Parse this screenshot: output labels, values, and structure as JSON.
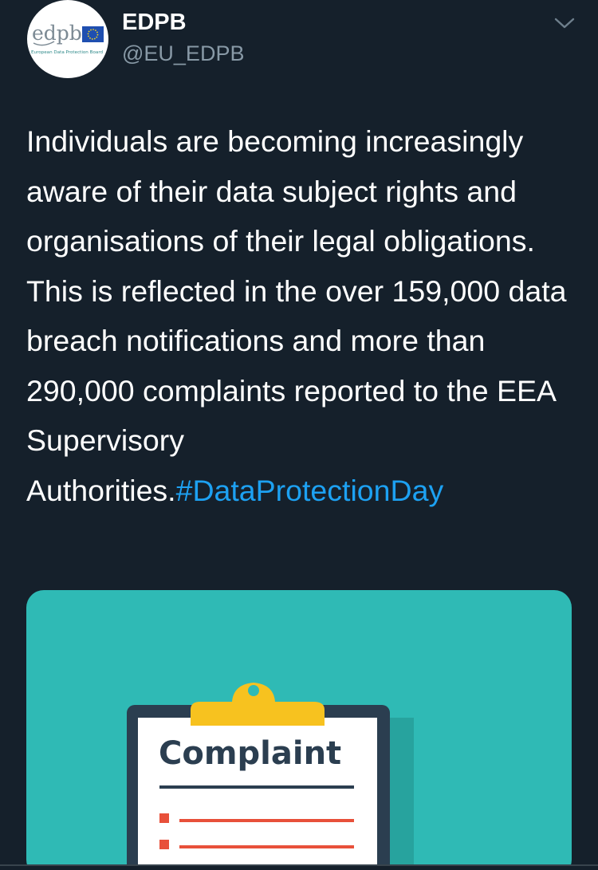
{
  "tweet": {
    "display_name": "EDPB",
    "handle": "@EU_EDPB",
    "avatar": {
      "logo_text": "edpb",
      "logo_subtitle": "European Data Protection Board"
    },
    "text": "Individuals are becoming increasingly aware of their data subject rights and organisations of their legal obligations. This is reflected in the over 159,000 data breach notifications and more than 290,000 complaints reported to the EEA Supervisory Authorities.",
    "hashtag": "#DataProtectionDay",
    "media": {
      "clipboard_title": "Complaint"
    },
    "menu_icon": "chevron-down-icon"
  },
  "colors": {
    "background": "#15202b",
    "text": "#ffffff",
    "secondary_text": "#8899a6",
    "link": "#1da1f2",
    "media_background": "#2fbab5",
    "clipboard_clip": "#f7c21f",
    "clipboard_board": "#2b3e50",
    "list_accent": "#e8503a"
  }
}
